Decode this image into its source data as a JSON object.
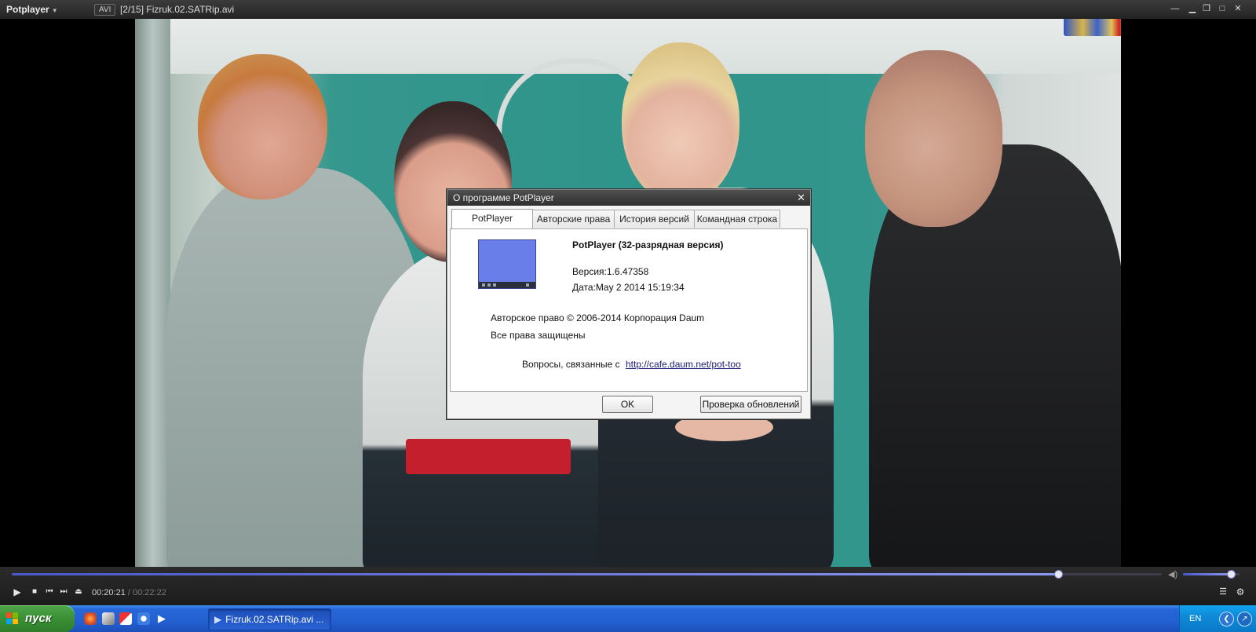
{
  "titlebar": {
    "app_name": "Potplayer",
    "format_badge": "AVI",
    "file_title": "[2/15] Fizruk.02.SATRip.avi"
  },
  "dialog": {
    "title": "О программе PotPlayer",
    "tabs": [
      "PotPlayer",
      "Авторские права",
      "История версий",
      "Командная строка"
    ],
    "active_tab": "PotPlayer",
    "product": "PotPlayer (32-разрядная версия)",
    "version": "Версия:1.6.47358",
    "date": "Дата:May  2 2014 15:19:34",
    "copyright": "Авторское право © 2006-2014 Корпорация Daum",
    "rights": "Все права защищены",
    "questions_label": "Вопросы, связанные с",
    "link": "http://cafe.daum.net/pot-too",
    "ok_button": "OK",
    "update_button": "Проверка обновлений"
  },
  "playback": {
    "current_time": "00:20:21",
    "separator": "/",
    "total_time": "00:22:22",
    "progress_fraction": 0.91,
    "volume_fraction": 0.85
  },
  "taskbar": {
    "start_label": "пуск",
    "task_title": "Fizruk.02.SATRip.avi ...",
    "language": "EN"
  },
  "icons": {
    "accent": "#5b6bdc",
    "taskbar_blue": "#2461d2",
    "start_green": "#3a8f35"
  }
}
